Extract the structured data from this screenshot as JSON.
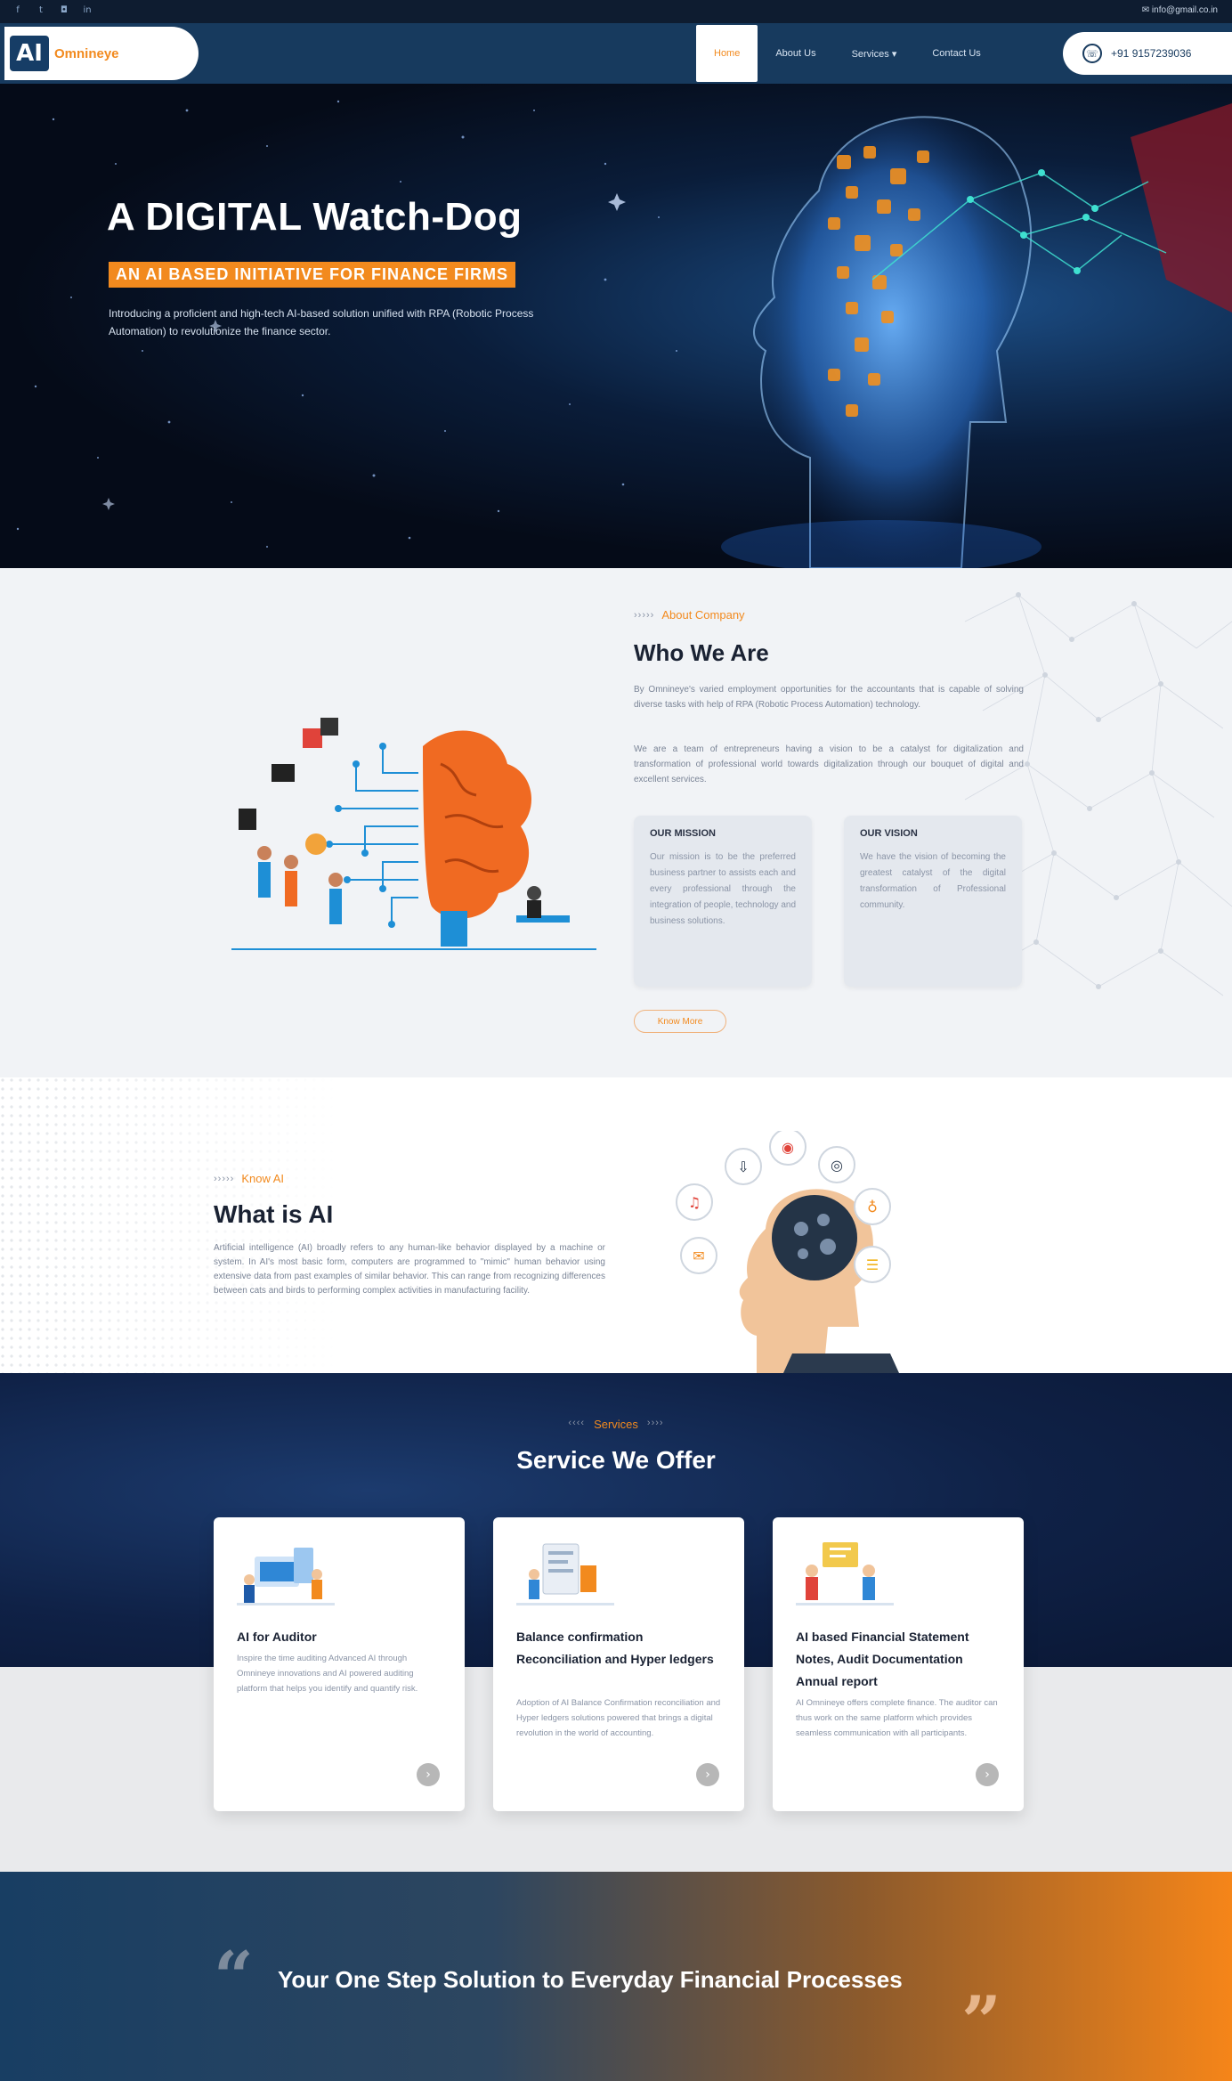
{
  "topbar": {
    "social_icons": [
      "facebook-icon",
      "twitter-icon",
      "instagram-icon",
      "linkedin-icon"
    ],
    "email": "info@gmail.co.in"
  },
  "nav": {
    "logo_mark": "AI",
    "logo_text": "Omnineye",
    "links": [
      {
        "label": "Home",
        "active": true
      },
      {
        "label": "About Us",
        "active": false
      },
      {
        "label": "Services ▾",
        "active": false
      },
      {
        "label": "Contact Us",
        "active": false
      }
    ],
    "phone": "+91 9157239036"
  },
  "hero": {
    "title": "A DIGITAL Watch-Dog",
    "tagline": "AN AI BASED INITIATIVE FOR FINANCE FIRMS",
    "description": "Introducing a proficient and high-tech AI-based solution unified with RPA (Robotic Process Automation) to revolutionize the finance sector."
  },
  "about": {
    "eyebrow_dots": "›››››",
    "eyebrow": "About Company",
    "title": "Who We Are",
    "p1": "By Omnineye's varied employment opportunities for the accountants that is capable of solving diverse tasks with help of RPA (Robotic Process Automation) technology.",
    "p2": "We are a team of entrepreneurs having a vision to be a catalyst for digitalization and transformation of professional world towards digitalization through our bouquet of digital and excellent services.",
    "mission_title": "OUR MISSION",
    "mission_text": "Our mission is to be the preferred business partner to assists each and every professional through the integration of people, technology and business solutions.",
    "vision_title": "OUR VISION",
    "vision_text": "We have the vision of becoming the greatest catalyst of the digital transformation of Professional community.",
    "button": "Know More"
  },
  "whatai": {
    "eyebrow_dots": "›››››",
    "eyebrow": "Know AI",
    "title": "What is AI",
    "description": "Artificial intelligence (AI) broadly refers to any human-like behavior displayed by a machine or system. In AI's most basic form, computers are programmed to \"mimic\" human behavior using extensive data from past examples of similar behavior. This can range from recognizing differences between cats and birds to performing complex activities in manufacturing facility."
  },
  "services": {
    "eyebrow_left": "‹‹‹‹",
    "eyebrow": "Services",
    "eyebrow_right": "››››",
    "title": "Service We Offer",
    "cards": [
      {
        "title": "AI for Auditor",
        "text": "Inspire the time auditing Advanced AI through Omnineye innovations and AI powered auditing platform that helps you identify and quantify risk."
      },
      {
        "title": "Balance confirmation Reconciliation and Hyper ledgers",
        "text": "Adoption of AI Balance Confirmation reconciliation and Hyper ledgers solutions powered that brings a digital revolution in the world of accounting."
      },
      {
        "title": "AI based Financial Statement Notes, Audit Documentation Annual report",
        "text": "AI Omnineye offers complete finance. The auditor can thus work on the same platform which provides seamless communication with all participants."
      }
    ],
    "arrow": "›"
  },
  "banner": {
    "quote_open": "“",
    "text": "Your One Step Solution to Everyday Financial Processes",
    "quote_close": "”"
  }
}
